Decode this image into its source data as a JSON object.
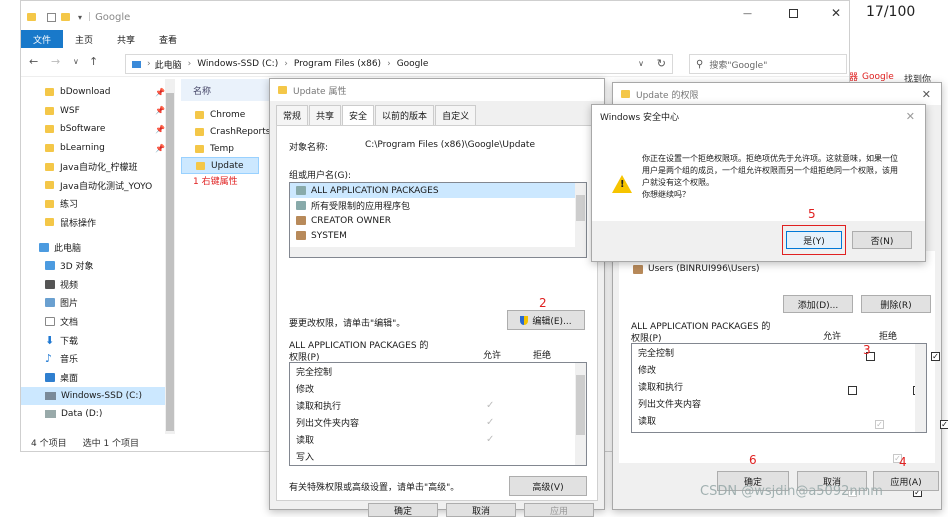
{
  "explorer": {
    "title": "Google",
    "ribbon": [
      "文件",
      "主页",
      "共享",
      "查看"
    ],
    "breadcrumb": [
      "此电脑",
      "Windows-SSD (C:)",
      "Program Files (x86)",
      "Google"
    ],
    "search_placeholder": "搜索\"Google\"",
    "nav_items": [
      {
        "label": "bDownload",
        "pinned": true
      },
      {
        "label": "WSF",
        "pinned": true
      },
      {
        "label": "bSoftware",
        "pinned": true
      },
      {
        "label": "bLearning",
        "pinned": true
      },
      {
        "label": "Java自动化_柠檬班",
        "pinned": false
      },
      {
        "label": "Java自动化测试_YOYO",
        "pinned": false
      },
      {
        "label": "练习",
        "pinned": false
      },
      {
        "label": "鼠标操作",
        "pinned": false
      }
    ],
    "pc_label": "此电脑",
    "pc_items": [
      "3D 对象",
      "视频",
      "图片",
      "文档",
      "下载",
      "音乐",
      "桌面",
      "Windows-SSD (C:)",
      "Data (D:)"
    ],
    "column_name": "名称",
    "files": [
      "Chrome",
      "CrashReports",
      "Temp",
      "Update"
    ],
    "status_count": "4 个项目",
    "status_selected": "选中 1 个项目"
  },
  "annotations": {
    "a1": "1 右键属性",
    "a2": "2",
    "a3": "3",
    "a4": "4",
    "a5": "5",
    "a6": "6"
  },
  "browser_tab": {
    "counter": "17/100",
    "text": "Google",
    "label_e": "器",
    "find": "找到你"
  },
  "props": {
    "title": "Update 属性",
    "tabs": [
      "常规",
      "共享",
      "安全",
      "以前的版本",
      "自定义"
    ],
    "object_label": "对象名称:",
    "object_value": "C:\\Program Files (x86)\\Google\\Update",
    "group_label": "组或用户名(G):",
    "groups": [
      "ALL APPLICATION PACKAGES",
      "所有受限制的应用程序包",
      "CREATOR OWNER",
      "SYSTEM"
    ],
    "edit_hint": "要更改权限，请单击\"编辑\"。",
    "edit_button": "编辑(E)...",
    "perm_title": "ALL APPLICATION PACKAGES 的",
    "perm_label": "权限(P)",
    "allow": "允许",
    "deny": "拒绝",
    "perms": [
      "完全控制",
      "修改",
      "读取和执行",
      "列出文件夹内容",
      "读取",
      "写入"
    ],
    "adv_hint": "有关特殊权限或高级设置，请单击\"高级\"。",
    "adv_button": "高级(V)",
    "buttons": [
      "确定",
      "取消",
      "应用"
    ]
  },
  "perms_dialog": {
    "title": "Update 的权限",
    "close": "✕",
    "hidden_item": "Users (BINRUI996\\Users)",
    "add_button": "添加(D)...",
    "remove_button": "删除(R)",
    "perm_title": "ALL APPLICATION PACKAGES 的",
    "perm_label": "权限(P)",
    "allow": "允许",
    "deny": "拒绝",
    "perms": [
      {
        "name": "完全控制",
        "allow": false,
        "deny": true,
        "allow_gray": false
      },
      {
        "name": "修改",
        "allow": false,
        "deny": true,
        "allow_gray": false
      },
      {
        "name": "读取和执行",
        "allow": true,
        "deny": true,
        "allow_gray": true
      },
      {
        "name": "列出文件夹内容",
        "allow": true,
        "deny": true,
        "allow_gray": true
      },
      {
        "name": "读取",
        "allow": true,
        "deny": true,
        "allow_gray": true
      }
    ],
    "ok_button": "确定",
    "cancel_button": "取消",
    "apply_button": "应用(A)"
  },
  "security": {
    "title": "Windows 安全中心",
    "message": "你正在设置一个拒绝权限项。拒绝项优先于允许项。这就意味，如果一位用户是两个组的成员，一个组允许权限而另一个组拒绝同一个权限，该用户就没有这个权限。",
    "question": "你想继续吗？",
    "yes_button": "是(Y)",
    "no_button": "否(N)"
  },
  "watermark": "CSDN @wsjdin@a5092nmm"
}
